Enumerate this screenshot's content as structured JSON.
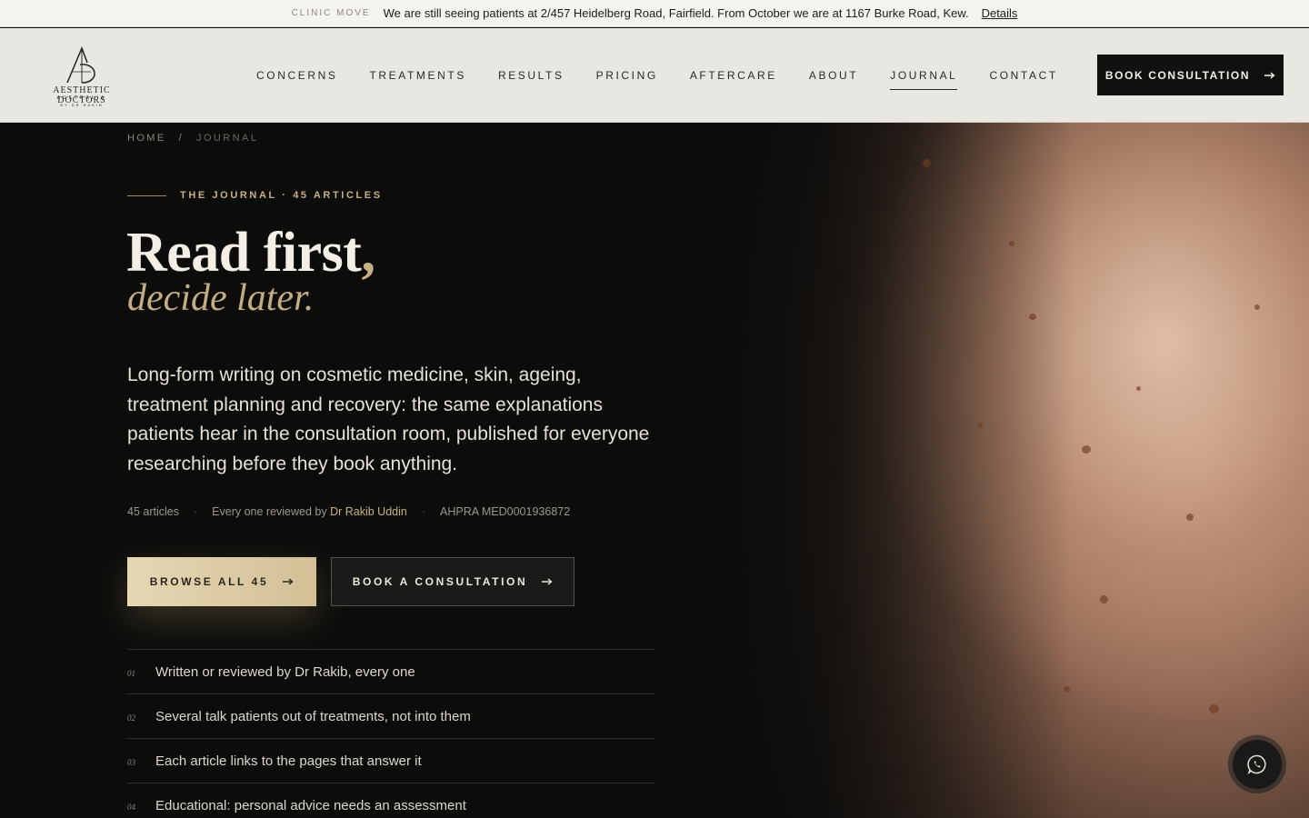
{
  "announcement": {
    "tag": "CLINIC MOVE",
    "message": "We are still seeing patients at 2/457 Heidelberg Road, Fairfield. From October we are at 1167 Burke Road, Kew.",
    "link": "Details"
  },
  "brand": {
    "logo_mark": "AD",
    "name": "AESTHETIC DOCTORS",
    "sub": "AUSTRALIA",
    "sub2": "BY DR RAKIB"
  },
  "nav": {
    "items": [
      {
        "label": "CONCERNS",
        "active": false
      },
      {
        "label": "TREATMENTS",
        "active": false
      },
      {
        "label": "RESULTS",
        "active": false
      },
      {
        "label": "PRICING",
        "active": false
      },
      {
        "label": "AFTERCARE",
        "active": false
      },
      {
        "label": "ABOUT",
        "active": false
      },
      {
        "label": "JOURNAL",
        "active": true
      },
      {
        "label": "CONTACT",
        "active": false
      }
    ],
    "cta": "BOOK CONSULTATION"
  },
  "breadcrumb": {
    "home": "HOME",
    "sep": "/",
    "current": "JOURNAL"
  },
  "hero": {
    "eyebrow": "THE JOURNAL · 45 ARTICLES",
    "title": "Read first",
    "title_comma": ",",
    "title_italic": "decide later.",
    "lead": "Long-form writing on cosmetic medicine, skin, ageing, treatment planning and recovery: the same explanations patients hear in the consultation room, published for everyone researching before they book anything.",
    "meta": {
      "count": "45 articles",
      "reviewed_prefix": "Every one reviewed by",
      "reviewer": "Dr Rakib Uddin",
      "ahpra": "AHPRA MED0001936872"
    },
    "primary_button": "BROWSE ALL 45",
    "secondary_button": "BOOK A CONSULTATION",
    "list": [
      {
        "num": "01",
        "text": "Written or reviewed by Dr Rakib, every one"
      },
      {
        "num": "02",
        "text": "Several talk patients out of treatments, not into them"
      },
      {
        "num": "03",
        "text": "Each article links to the pages that answer it"
      },
      {
        "num": "04",
        "text": "Educational: personal advice needs an assessment"
      }
    ]
  },
  "icons": {
    "arrow": "arrow-right-icon",
    "whatsapp": "whatsapp-icon"
  },
  "colors": {
    "accent_gold": "#c8b186",
    "dark_bg": "#0c0c0b",
    "header_bg": "#e9e7e2"
  }
}
